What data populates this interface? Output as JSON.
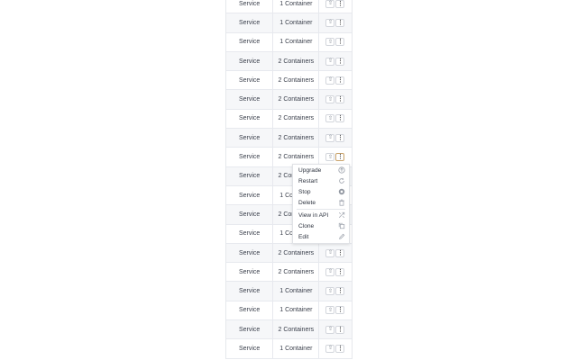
{
  "rows": [
    {
      "type": "Service",
      "scale": "1 Container"
    },
    {
      "type": "Service",
      "scale": "1 Container"
    },
    {
      "type": "Service",
      "scale": "1 Container"
    },
    {
      "type": "Service",
      "scale": "2 Containers"
    },
    {
      "type": "Service",
      "scale": "2 Containers"
    },
    {
      "type": "Service",
      "scale": "2 Containers"
    },
    {
      "type": "Service",
      "scale": "2 Containers"
    },
    {
      "type": "Service",
      "scale": "2 Containers"
    },
    {
      "type": "Service",
      "scale": "2 Containers"
    },
    {
      "type": "Service",
      "scale": "2 Containers"
    },
    {
      "type": "Service",
      "scale": "1 Container"
    },
    {
      "type": "Service",
      "scale": "2 Containers"
    },
    {
      "type": "Service",
      "scale": "1 Container"
    },
    {
      "type": "Service",
      "scale": "2 Containers"
    },
    {
      "type": "Service",
      "scale": "2 Containers"
    },
    {
      "type": "Service",
      "scale": "1 Container"
    },
    {
      "type": "Service",
      "scale": "1 Container"
    },
    {
      "type": "Service",
      "scale": "2 Containers"
    },
    {
      "type": "Service",
      "scale": "1 Container"
    }
  ],
  "menu": {
    "upgrade": "Upgrade",
    "restart": "Restart",
    "stop": "Stop",
    "delete": "Delete",
    "view_api": "View in API",
    "clone": "Clone",
    "edit": "Edit"
  },
  "icons": {
    "row_action": "upgrade-icon",
    "row_more": "more-icon"
  },
  "colors": {
    "active_border": "#c9a36b",
    "row_divider": "#e7e9ee"
  }
}
